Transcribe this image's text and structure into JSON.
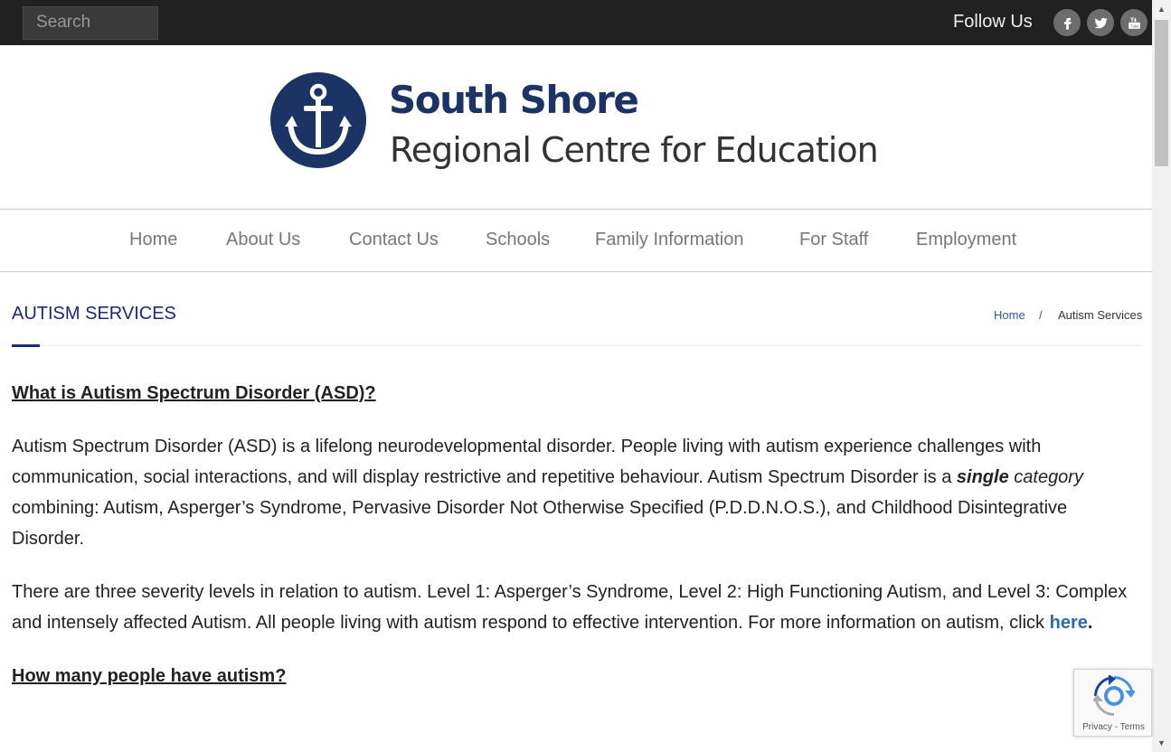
{
  "topbar": {
    "search_placeholder": "Search",
    "follow_label": "Follow Us",
    "social_icons": [
      "facebook-icon",
      "twitter-icon",
      "youtube-icon"
    ]
  },
  "logo": {
    "line1": "South Shore",
    "line2": "Regional Centre for Education",
    "brand_color": "#1b3365"
  },
  "nav": {
    "items": [
      "Home",
      "About Us",
      "Contact Us",
      "Schools",
      "Family Information",
      "For Staff",
      "Employment"
    ]
  },
  "page": {
    "title": "AUTISM SERVICES",
    "breadcrumb": {
      "home": "Home",
      "separator": "/",
      "current": "Autism Services"
    }
  },
  "content": {
    "heading1": "What is Autism Spectrum Disorder (ASD)?",
    "p1_part1": "Autism Spectrum Disorder (ASD) is a lifelong neurodevelopmental disorder. People living with autism experience challenges with communication, social interactions, and will display restrictive and repetitive behaviour. Autism Spectrum Disorder is a ",
    "p1_bold": "single",
    "p1_italic": " category",
    "p1_part2": " combining: Autism, Asperger’s Syndrome, Pervasive Disorder Not Otherwise Specified (P.D.D.N.O.S.), and Childhood Disintegrative Disorder.",
    "p2_text": "There are three severity levels in relation to autism. Level 1: Asperger’s Syndrome, Level 2: High Functioning Autism, and Level 3: Complex and intensely affected Autism. All people living with autism respond to effective intervention. For more information on autism, click ",
    "p2_link": "here",
    "p2_end": ".",
    "heading2": "How many people have autism?"
  },
  "recaptcha": {
    "privacy": "Privacy",
    "separator": " - ",
    "terms": "Terms"
  },
  "colors": {
    "accent": "#1b2a78",
    "link": "#2b6cb0",
    "topbar": "#212121"
  }
}
